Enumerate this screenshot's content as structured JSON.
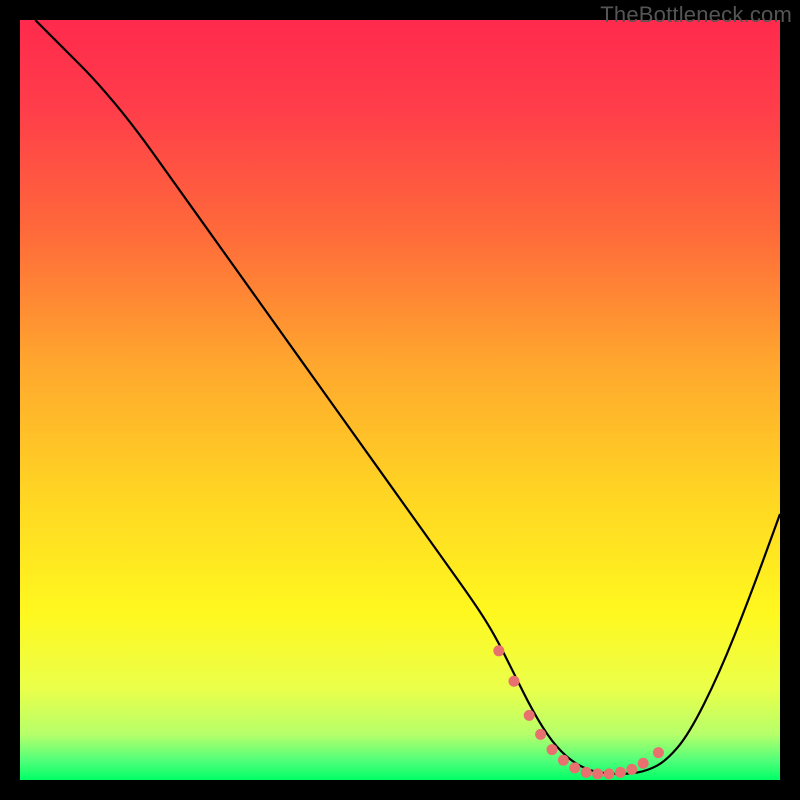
{
  "watermark": "TheBottleneck.com",
  "gradient": {
    "stops": [
      {
        "offset": 0.0,
        "color": "#ff2a4d"
      },
      {
        "offset": 0.12,
        "color": "#ff3e4a"
      },
      {
        "offset": 0.28,
        "color": "#ff6a3a"
      },
      {
        "offset": 0.45,
        "color": "#ffa62e"
      },
      {
        "offset": 0.62,
        "color": "#ffd423"
      },
      {
        "offset": 0.78,
        "color": "#fff81f"
      },
      {
        "offset": 0.88,
        "color": "#eaff4a"
      },
      {
        "offset": 0.94,
        "color": "#b6ff6a"
      },
      {
        "offset": 0.975,
        "color": "#4fff7a"
      },
      {
        "offset": 1.0,
        "color": "#00ff66"
      }
    ]
  },
  "colors": {
    "curve": "#000000",
    "markers": "#e8706f",
    "background": "#000000"
  },
  "chart_data": {
    "type": "line",
    "title": "",
    "xlabel": "",
    "ylabel": "",
    "xlim": [
      0,
      100
    ],
    "ylim": [
      0,
      100
    ],
    "grid": false,
    "series": [
      {
        "name": "bottleneck-curve",
        "x": [
          2,
          6,
          10,
          15,
          20,
          25,
          30,
          35,
          40,
          45,
          50,
          55,
          60,
          62.5,
          65,
          67.5,
          70,
          72.5,
          75,
          77.5,
          80,
          82.5,
          85,
          88,
          92,
          96,
          100
        ],
        "y": [
          100,
          96,
          92,
          86,
          79,
          72,
          65,
          58,
          51,
          44,
          37,
          30,
          23,
          19,
          14,
          9,
          5,
          2.5,
          1.2,
          0.8,
          0.8,
          1.2,
          2.5,
          6,
          14,
          24,
          35
        ]
      }
    ],
    "marker_points": {
      "name": "flat-region-markers",
      "x": [
        63,
        65,
        67,
        68.5,
        70,
        71.5,
        73,
        74.5,
        76,
        77.5,
        79,
        80.5,
        82,
        84
      ],
      "y": [
        17,
        13,
        8.5,
        6,
        4,
        2.6,
        1.6,
        1.0,
        0.8,
        0.8,
        1.0,
        1.4,
        2.2,
        3.6
      ]
    }
  }
}
